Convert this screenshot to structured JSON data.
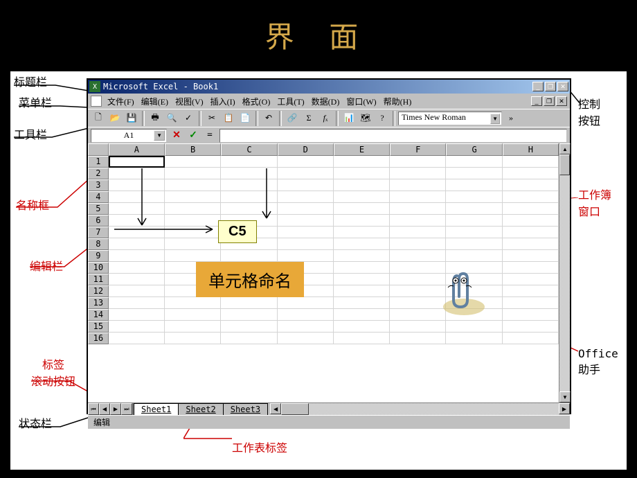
{
  "slide": {
    "title": "界 面"
  },
  "labels": {
    "titlebar": "标题栏",
    "menubar": "菜单栏",
    "toolbar": "工具栏",
    "namebox": "名称框",
    "formulabar": "编辑栏",
    "tabscroll": "标签\n滚动按钮",
    "statusbar": "状态栏",
    "controlbtns": "控制\n按钮",
    "workbookwin": "工作簿\n窗口",
    "assistant": "Office\n助手",
    "sheettabs": "工作表标签"
  },
  "window": {
    "title": "Microsoft Excel - Book1"
  },
  "menus": [
    "文件(F)",
    "编辑(E)",
    "视图(V)",
    "插入(I)",
    "格式(O)",
    "工具(T)",
    "数据(D)",
    "窗口(W)",
    "帮助(H)"
  ],
  "font": "Times New Roman",
  "namebox_value": "A1",
  "columns": [
    "A",
    "B",
    "C",
    "D",
    "E",
    "F",
    "G",
    "H"
  ],
  "rows": [
    "1",
    "2",
    "3",
    "4",
    "5",
    "6",
    "7",
    "8",
    "9",
    "10",
    "11",
    "12",
    "13",
    "14",
    "15",
    "16"
  ],
  "sheets": [
    "Sheet1",
    "Sheet2",
    "Sheet3"
  ],
  "status": "编辑",
  "callout": {
    "c5": "C5",
    "naming": "单元格命名"
  }
}
